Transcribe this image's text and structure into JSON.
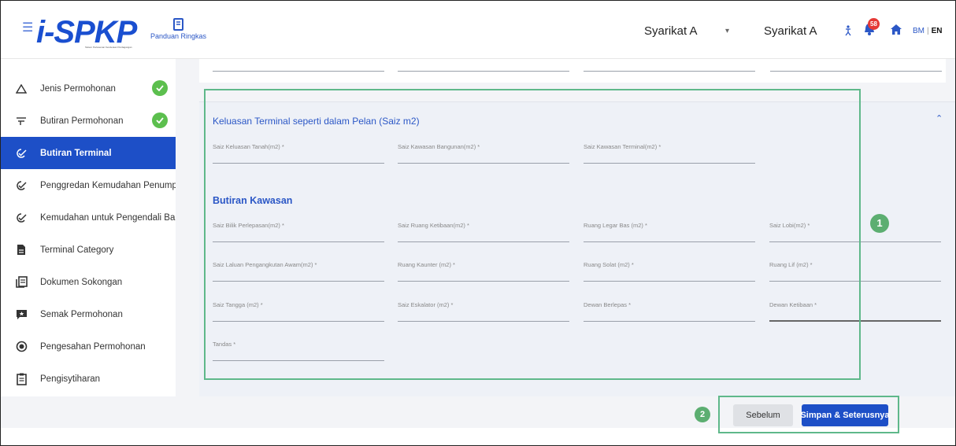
{
  "header": {
    "logo_text": "i-SPKP",
    "logo_subtitle": "Sistem Perlesenan Kenderaan Perdagangan",
    "guide_label": "Panduan Ringkas",
    "company_left": "Syarikat A",
    "company_right": "Syarikat A",
    "notification_count": "58",
    "lang_bm": "BM",
    "lang_en": "EN"
  },
  "sidebar": {
    "items": [
      {
        "label": "Jenis Permohonan",
        "icon": "triangle-icon",
        "completed": true
      },
      {
        "label": "Butiran Permohonan",
        "icon": "filter-icon",
        "completed": true
      },
      {
        "label": "Butiran Terminal",
        "icon": "clock-check-icon",
        "active": true
      },
      {
        "label": "Penggredan Kemudahan Penump...",
        "icon": "clock-check-icon"
      },
      {
        "label": "Kemudahan untuk Pengendali Ba...",
        "icon": "clock-check-icon"
      },
      {
        "label": "Terminal Category",
        "icon": "document-icon"
      },
      {
        "label": "Dokumen Sokongan",
        "icon": "documents-icon"
      },
      {
        "label": "Semak Permohonan",
        "icon": "review-icon"
      },
      {
        "label": "Pengesahan Permohonan",
        "icon": "check-circle-icon"
      },
      {
        "label": "Pengisytiharan",
        "icon": "clipboard-icon"
      }
    ]
  },
  "main": {
    "section_title": "Keluasan Terminal seperti dalam Pelan (Saiz m2)",
    "section_fields": [
      "Saiz Keluasan Tanah(m2) *",
      "Saiz Kawasan Bangunan(m2) *",
      "Saiz Kawasan Terminal(m2) *"
    ],
    "subsection_title": "Butiran Kawasan",
    "area_fields": [
      "Saiz Bilik Perlepasan(m2) *",
      "Saiz Ruang Ketibaan(m2) *",
      "Ruang Legar Bas (m2) *",
      "Saiz Lobi(m2) *",
      "Saiz Laluan Pengangkutan Awam(m2) *",
      "Ruang Kaunter (m2) *",
      "Ruang Solat (m2) *",
      "Ruang Lif (m2) *",
      "Saiz Tangga (m2) *",
      "Saiz Eskalator (m2) *",
      "Dewan Berlepas *",
      "Dewan Ketibaan *",
      "Tandas *"
    ]
  },
  "footer": {
    "prev_label": "Sebelum",
    "next_label": "Simpan & Seterusnya"
  },
  "annotations": {
    "one": "1",
    "two": "2"
  },
  "colors": {
    "primary": "#1d4fc7",
    "success": "#5cbf4e",
    "annotation": "#5fb88a",
    "badge": "#e53935"
  }
}
